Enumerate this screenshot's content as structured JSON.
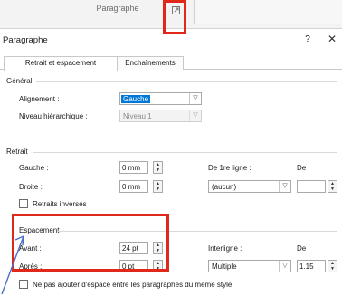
{
  "ribbon": {
    "group_label": "Paragraphe",
    "launcher_icon": "dialog-launcher-icon"
  },
  "dialog": {
    "title": "Paragraphe",
    "help_label": "?",
    "close_label": "✕"
  },
  "tabs": [
    {
      "label": "Retrait et espacement",
      "active": true
    },
    {
      "label": "Enchaînements",
      "active": false
    }
  ],
  "general": {
    "section": "Général",
    "alignment_label": "Alignement :",
    "alignment_value": "Gauche",
    "level_label": "Niveau hiérarchique :",
    "level_value": "Niveau 1"
  },
  "indent": {
    "section": "Retrait",
    "left_label": "Gauche :",
    "left_value": "0 mm",
    "right_label": "Droite :",
    "right_value": "0 mm",
    "first_line_label": "De 1re ligne :",
    "first_line_value": "(aucun)",
    "by_label": "De :",
    "by_value": "",
    "mirror_label": "Retraits inversés",
    "mirror_checked": false
  },
  "spacing": {
    "section": "Espacement",
    "before_label": "Avant :",
    "before_value": "24 pt",
    "after_label": "Après :",
    "after_value": "0 pt",
    "line_spacing_label": "Interligne :",
    "line_spacing_value": "Multiple",
    "at_label": "De :",
    "at_value": "1.15",
    "dont_add_label": "Ne pas ajouter d'espace entre les paragraphes du même style",
    "dont_add_checked": false
  },
  "annotations": {
    "highlight_color": "#e0281a",
    "arrow_color": "#4a6fc7"
  }
}
